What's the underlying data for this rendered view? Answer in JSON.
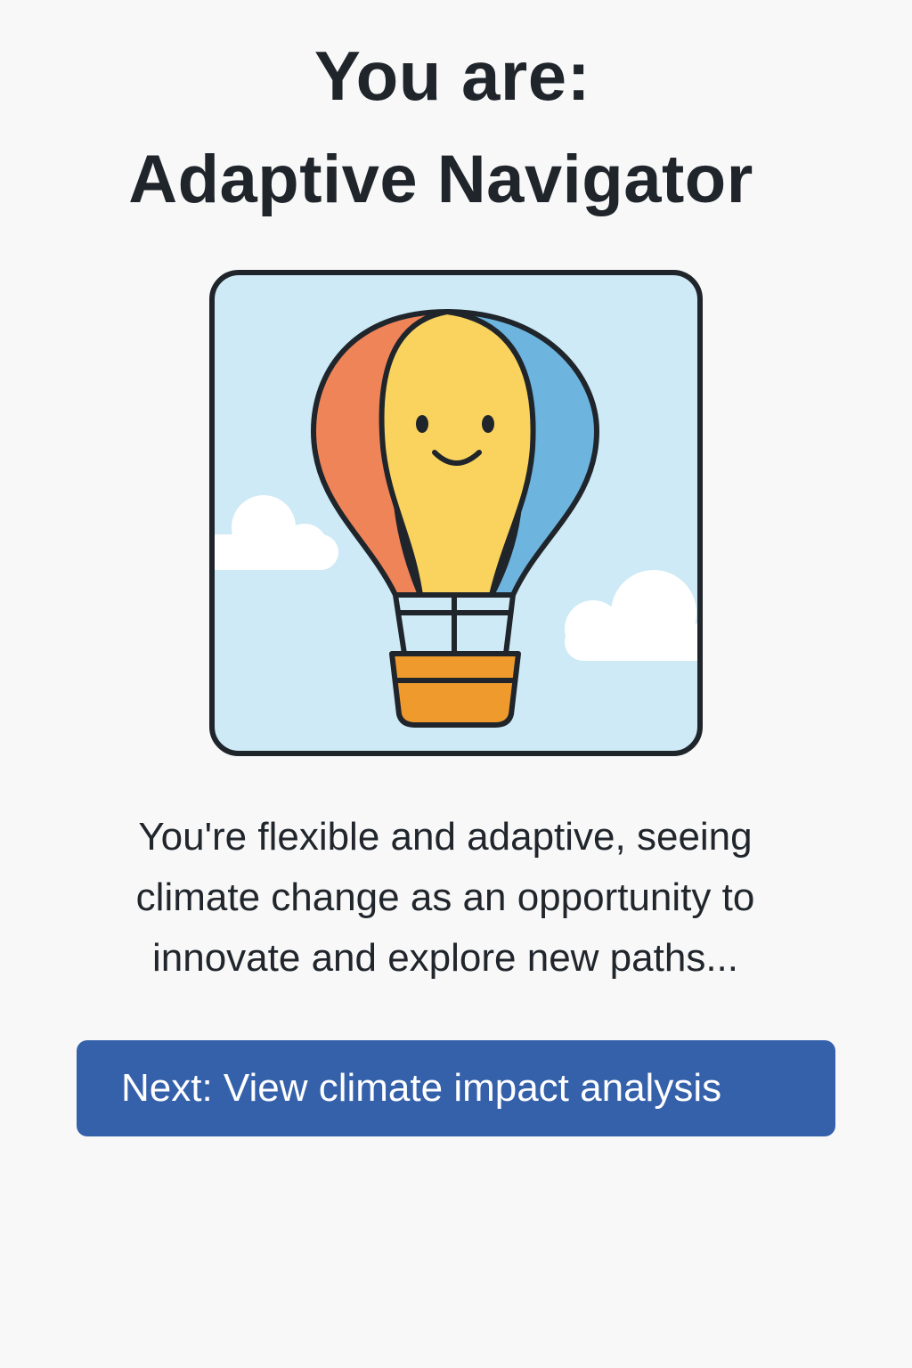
{
  "header": {
    "title_line_1": "You are:",
    "title_line_2": "Adaptive Navigator"
  },
  "illustration": {
    "icon": "hot-air-balloon-icon",
    "colors": {
      "sky": "#cdeaf6",
      "left_panel": "#ee8458",
      "center_panel": "#f9d35e",
      "right_panel": "#6db4de",
      "basket": "#ef9a2d",
      "outline": "#1f252b",
      "cloud": "#ffffff"
    }
  },
  "description": {
    "line_1": "You're flexible and adaptive, seeing",
    "line_2": "climate change as an opportunity to",
    "line_3": "innovate and explore new paths..."
  },
  "next_button": {
    "label": "Next: View climate impact analysis",
    "color": "#3561ab"
  }
}
